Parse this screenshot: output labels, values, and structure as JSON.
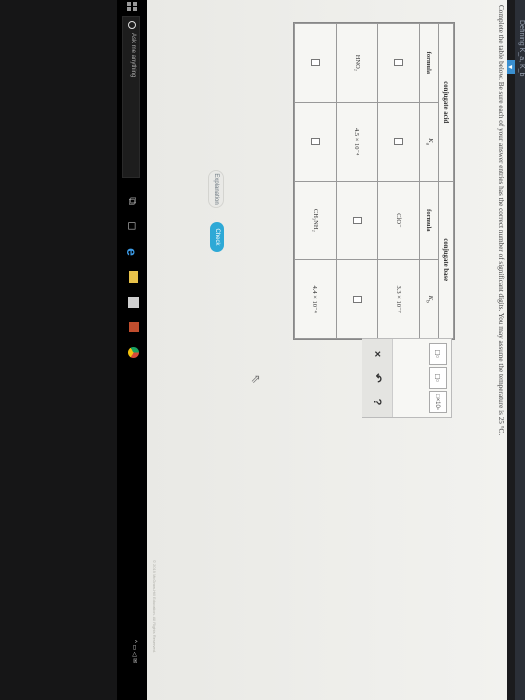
{
  "window": {
    "title": "Defining K_a, K_b"
  },
  "instruction": "Complete the table below. Be sure each of your answer entries has the correct number of significant digits. You may assume the temperature is 25 °C.",
  "table": {
    "acid_header": "conjugate acid",
    "base_header": "conjugate base",
    "col_formula": "formula",
    "col_ka_symbol": "K",
    "col_ka_sub": "a",
    "col_kb_symbol": "K",
    "col_kb_sub": "b",
    "rows": [
      {
        "acid_formula": "",
        "ka": "",
        "base_formula": "ClO⁻",
        "kb": "3.3 × 10⁻⁷"
      },
      {
        "acid_formula": "HNO₂",
        "ka": "4.5 × 10⁻⁴",
        "base_formula": "",
        "kb": ""
      },
      {
        "acid_formula": "",
        "ka": "",
        "base_formula": "CH₃NH₂",
        "kb": "4.4 × 10⁻⁴"
      }
    ]
  },
  "palette": {
    "subscript_label": "□▫",
    "superscript_label": "□▫",
    "sci_notation_label": "□×10▫",
    "clear_label": "×",
    "undo_label": "↶",
    "help_label": "?"
  },
  "buttons": {
    "explanation": "Explanation",
    "check": "Check"
  },
  "copyright": "© 2019 McGraw-Hill Education. All Rights Reserved.",
  "taskbar": {
    "search_placeholder": "Ask me anything"
  },
  "icons": {
    "start": "windows-start-icon",
    "search": "search-circle-icon",
    "task_view": "task-view-icon",
    "edge": "edge-icon",
    "explorer": "folder-icon",
    "store": "store-icon",
    "chrome": "chrome-icon",
    "cursor": "mouse-pointer-icon"
  },
  "colors": {
    "check_button": "#2ea9d6",
    "title_chevron": "#3a8fd0",
    "edge_icon": "#3c9ce8"
  }
}
